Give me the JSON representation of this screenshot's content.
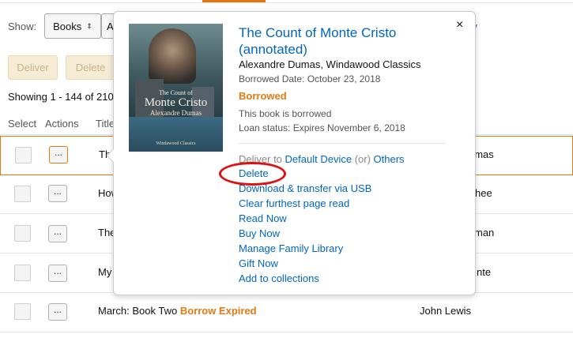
{
  "top_bar": {
    "accent_color": "#e47911"
  },
  "filter": {
    "show_label": "Show:",
    "type_select": "Books",
    "second_select": "A",
    "right_link": "ry"
  },
  "toolbar": {
    "deliver_label": "Deliver",
    "delete_label": "Delete"
  },
  "showing_text": "Showing 1 - 144 of 210",
  "columns": {
    "select": "Select",
    "actions": "Actions",
    "title": "Title"
  },
  "rows": [
    {
      "action": "...",
      "title": "Th",
      "author": "umas",
      "status": ""
    },
    {
      "action": "...",
      "title": "How",
      "author": "hee",
      "status": ""
    },
    {
      "action": "...",
      "title": "The",
      "author": "man",
      "status": ""
    },
    {
      "action": "...",
      "title": "My",
      "author": "nte",
      "status": ""
    },
    {
      "action": "...",
      "title": "March: Book Two ",
      "author": "John Lewis",
      "status": "Borrow Expired"
    }
  ],
  "popover": {
    "close": "×",
    "cover": {
      "line1": "The Count of",
      "line2": "Monte Cristo",
      "line3": "Alexandre Dumas",
      "line4": "Windawood Classics"
    },
    "title": "The Count of Monte Cristo (annotated)",
    "author": "Alexandre Dumas, Windawood Classics",
    "borrowed_date": "Borrowed Date: October 23, 2018",
    "status": "Borrowed",
    "note": "This book is borrowed",
    "loan_status": "Loan status: Expires  November 6, 2018",
    "deliver": {
      "prefix": "Deliver to ",
      "device": "Default Device",
      "or": " (or) ",
      "others": "Others"
    },
    "actions": [
      "Delete",
      "Download & transfer via USB",
      "Clear furthest page read",
      "Read Now",
      "Buy Now",
      "Manage Family Library",
      "Gift Now",
      "Add to collections"
    ]
  },
  "colors": {
    "link": "#0066c0",
    "orange": "#e47911",
    "highlight": "#e01010"
  }
}
